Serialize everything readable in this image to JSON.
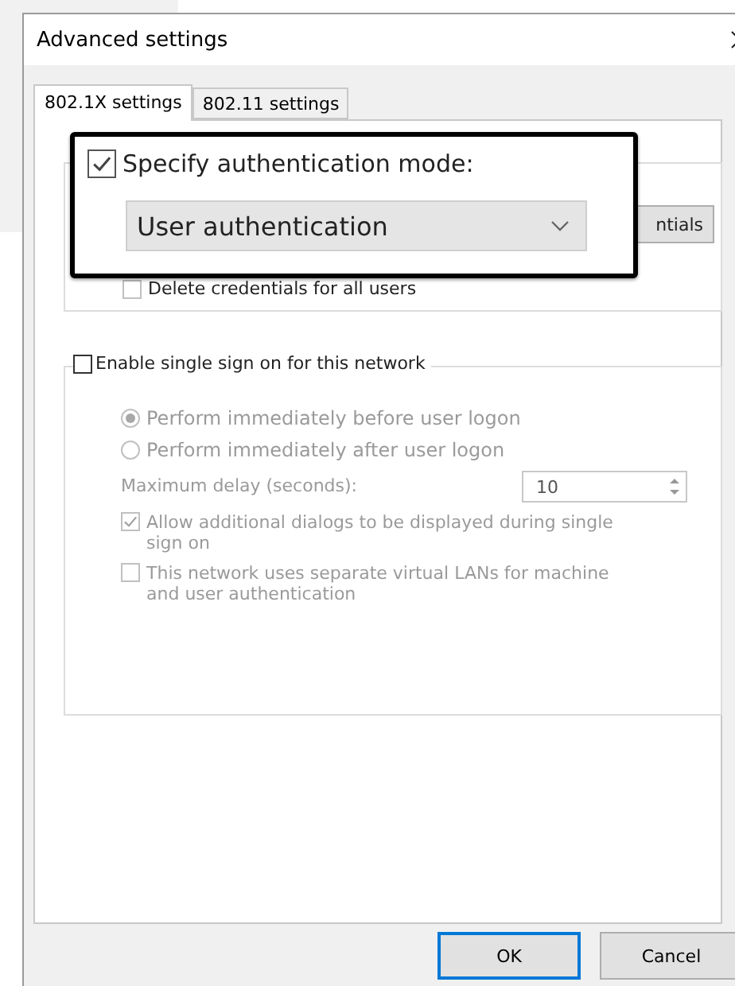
{
  "window": {
    "title": "Advanced settings"
  },
  "tabs": [
    {
      "label": "802.1X settings",
      "selected": true
    },
    {
      "label": "802.11 settings",
      "selected": false
    }
  ],
  "auth_group": {
    "button_partial": "ntials",
    "delete_credentials": {
      "label": "Delete credentials for all users",
      "checked": false
    }
  },
  "callout": {
    "checkbox": {
      "label": "Specify authentication mode:",
      "checked": true
    },
    "dropdown": {
      "value": "User authentication"
    }
  },
  "sso": {
    "enable": {
      "label": "Enable single sign on for this network",
      "checked": false
    },
    "options": [
      {
        "label": "Perform immediately before user logon",
        "selected": true,
        "disabled": true
      },
      {
        "label": "Perform immediately after user logon",
        "selected": false,
        "disabled": true
      }
    ],
    "delay": {
      "label": "Maximum delay (seconds):",
      "value": "10",
      "disabled": true
    },
    "checks": [
      {
        "label": "Allow additional dialogs to be displayed during single sign on",
        "checked": true,
        "disabled": true
      },
      {
        "label": "This network uses separate virtual LANs for machine and user authentication",
        "checked": false,
        "disabled": true
      }
    ]
  },
  "buttons": [
    {
      "label": "OK",
      "default": true
    },
    {
      "label": "Cancel",
      "default": false
    }
  ]
}
